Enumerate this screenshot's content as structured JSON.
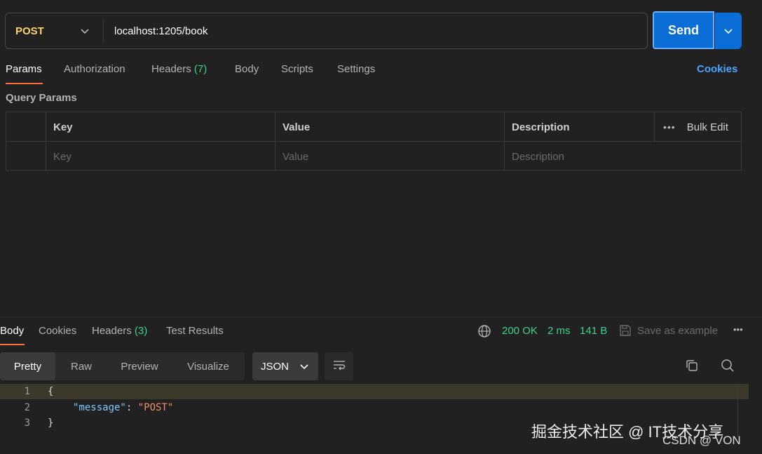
{
  "request": {
    "method": "POST",
    "url": "localhost:1205/book",
    "send_label": "Send"
  },
  "request_tabs": {
    "params": "Params",
    "authorization": "Authorization",
    "headers": "Headers",
    "headers_count": "(7)",
    "body": "Body",
    "scripts": "Scripts",
    "settings": "Settings",
    "cookies": "Cookies"
  },
  "query_params": {
    "title": "Query Params",
    "columns": {
      "key": "Key",
      "value": "Value",
      "description": "Description",
      "bulk_edit": "Bulk Edit"
    },
    "placeholders": {
      "key": "Key",
      "value": "Value",
      "description": "Description"
    }
  },
  "response_tabs": {
    "body": "Body",
    "cookies": "Cookies",
    "headers": "Headers",
    "headers_count": "(3)",
    "test_results": "Test Results"
  },
  "response_status": {
    "status": "200 OK",
    "time": "2 ms",
    "size": "141 B",
    "save_example": "Save as example"
  },
  "view_modes": {
    "pretty": "Pretty",
    "raw": "Raw",
    "preview": "Preview",
    "visualize": "Visualize",
    "format": "JSON"
  },
  "response_body": {
    "line_numbers": [
      "1",
      "2",
      "3"
    ],
    "open_brace": "{",
    "key": "\"message\"",
    "colon": ": ",
    "value": "\"POST\"",
    "close_brace": "}"
  },
  "watermark": {
    "line1": "掘金技术社区 @ IT技术分享",
    "line2": "CSDN @ VON"
  },
  "colors": {
    "background": "#212121",
    "accent_orange": "#ff6c37",
    "send_blue": "#0a6ed6",
    "method_yellow": "#ffd36a",
    "status_green": "#3fd18b",
    "link_blue": "#4aa3ff"
  }
}
